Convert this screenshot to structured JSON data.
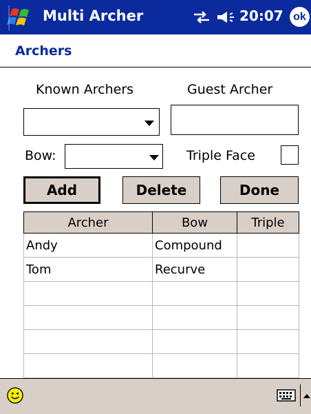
{
  "titlebar": {
    "app_title": "Multi Archer",
    "time": "20:07",
    "ok_label": "ok",
    "icons": [
      "windows-start-icon",
      "connectivity-icon",
      "volume-icon"
    ]
  },
  "page": {
    "title": "Archers"
  },
  "form": {
    "known_archers_label": "Known Archers",
    "guest_archer_label": "Guest Archer",
    "known_archers_value": "",
    "guest_archer_value": "",
    "bow_label": "Bow:",
    "bow_value": "",
    "triple_face_label": "Triple Face",
    "triple_face_checked": false
  },
  "buttons": {
    "add": "Add",
    "delete": "Delete",
    "done": "Done"
  },
  "table": {
    "columns": [
      "Archer",
      "Bow",
      "Triple"
    ],
    "rows": [
      [
        "Andy",
        "Compound",
        ""
      ],
      [
        "Tom",
        "Recurve",
        ""
      ],
      [
        "",
        "",
        ""
      ],
      [
        "",
        "",
        ""
      ],
      [
        "",
        "",
        ""
      ],
      [
        "",
        "",
        ""
      ]
    ]
  },
  "bottombar": {
    "icons": [
      "smiley-icon",
      "keyboard-icon",
      "sip-arrow-up-icon"
    ]
  },
  "colors": {
    "titlebar_bg": "#0b2a9e",
    "button_face": "#d8d0c8",
    "page_title": "#0b2a9e"
  }
}
